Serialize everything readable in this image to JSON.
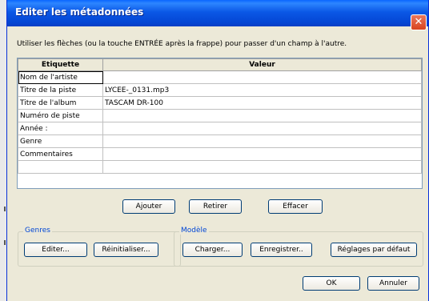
{
  "window": {
    "title": "Editer les métadonnées",
    "close_glyph": "✕"
  },
  "instruction": "Utiliser les flèches (ou la touche ENTRÉE après la frappe) pour passer d'un champ à l'autre.",
  "table": {
    "headers": [
      "Etiquette",
      "Valeur"
    ],
    "rows": [
      {
        "label": "Nom de l'artiste",
        "value": ""
      },
      {
        "label": "Titre de la piste",
        "value": "LYCEE-_0131.mp3"
      },
      {
        "label": "Titre de l'album",
        "value": "TASCAM DR-100"
      },
      {
        "label": "Numéro de piste",
        "value": ""
      },
      {
        "label": "Année :",
        "value": ""
      },
      {
        "label": "Genre",
        "value": ""
      },
      {
        "label": "Commentaires",
        "value": ""
      },
      {
        "label": "",
        "value": ""
      }
    ]
  },
  "row_buttons": {
    "add": "Ajouter",
    "remove": "Retirer",
    "clear": "Effacer"
  },
  "genres": {
    "legend": "Genres",
    "edit": "Editer...",
    "reset": "Réinitialiser..."
  },
  "template": {
    "legend": "Modèle",
    "load": "Charger...",
    "save": "Enregistrer..",
    "defaults": "Réglages par défaut"
  },
  "dialog": {
    "ok": "OK",
    "cancel": "Annuler"
  },
  "colors": {
    "titlebar": "#0b58e6",
    "dialog_bg": "#ece9d8",
    "legend_text": "#0046d5",
    "close_button": "#d9431d"
  }
}
